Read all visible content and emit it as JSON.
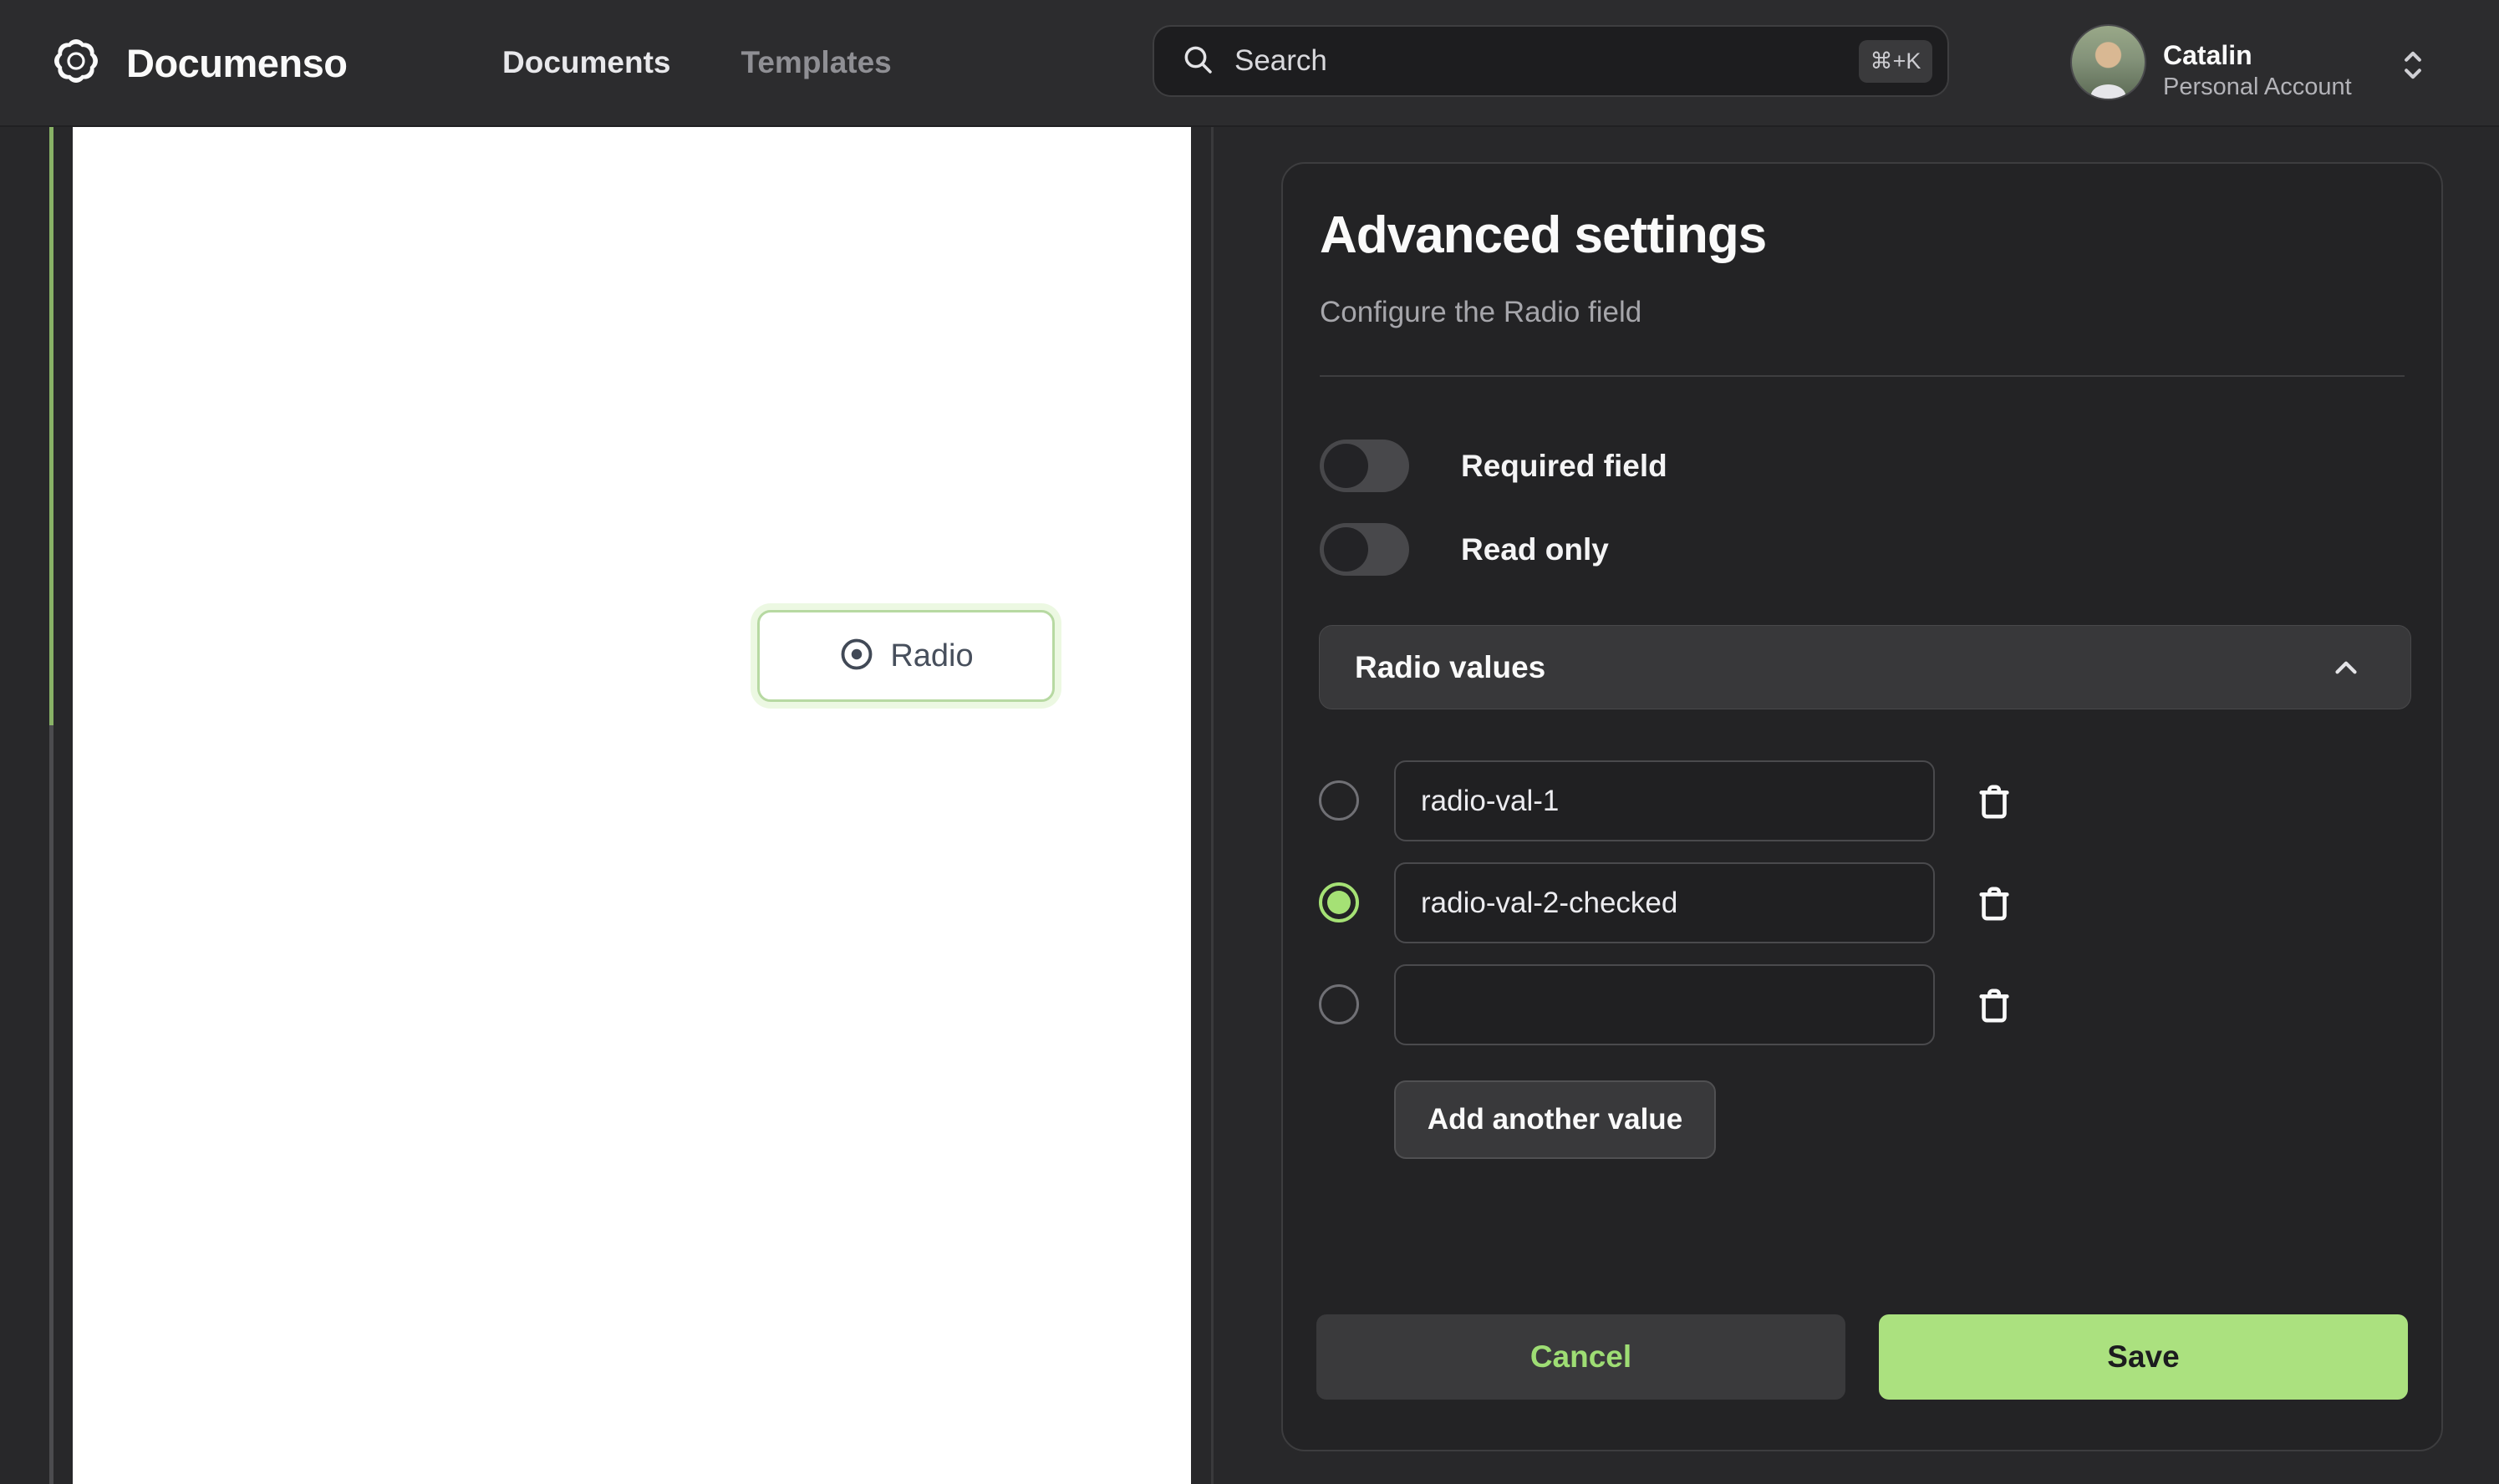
{
  "navbar": {
    "brand": "Documenso",
    "links": [
      {
        "label": "Documents",
        "active": true
      },
      {
        "label": "Templates",
        "active": false
      }
    ],
    "search": {
      "placeholder": "Search",
      "shortcut": "⌘+K"
    },
    "user": {
      "name": "Catalin",
      "account_type": "Personal Account"
    }
  },
  "document": {
    "field": {
      "label": "Radio"
    }
  },
  "panel": {
    "title": "Advanced settings",
    "subtitle": "Configure the Radio field",
    "toggles": [
      {
        "label": "Required field",
        "on": false
      },
      {
        "label": "Read only",
        "on": false
      }
    ],
    "section": {
      "label": "Radio values",
      "expanded": true
    },
    "radio_rows": [
      {
        "value": "radio-val-1",
        "checked": false
      },
      {
        "value": "radio-val-2-checked",
        "checked": true
      },
      {
        "value": "",
        "checked": false
      }
    ],
    "add_button": "Add another value",
    "cancel_button": "Cancel",
    "save_button": "Save"
  },
  "colors": {
    "accent_green": "#abe17f",
    "radio_checked_green": "#a5e175",
    "field_border_green": "#b7d9a2",
    "cancel_text_green": "#9edd74"
  }
}
